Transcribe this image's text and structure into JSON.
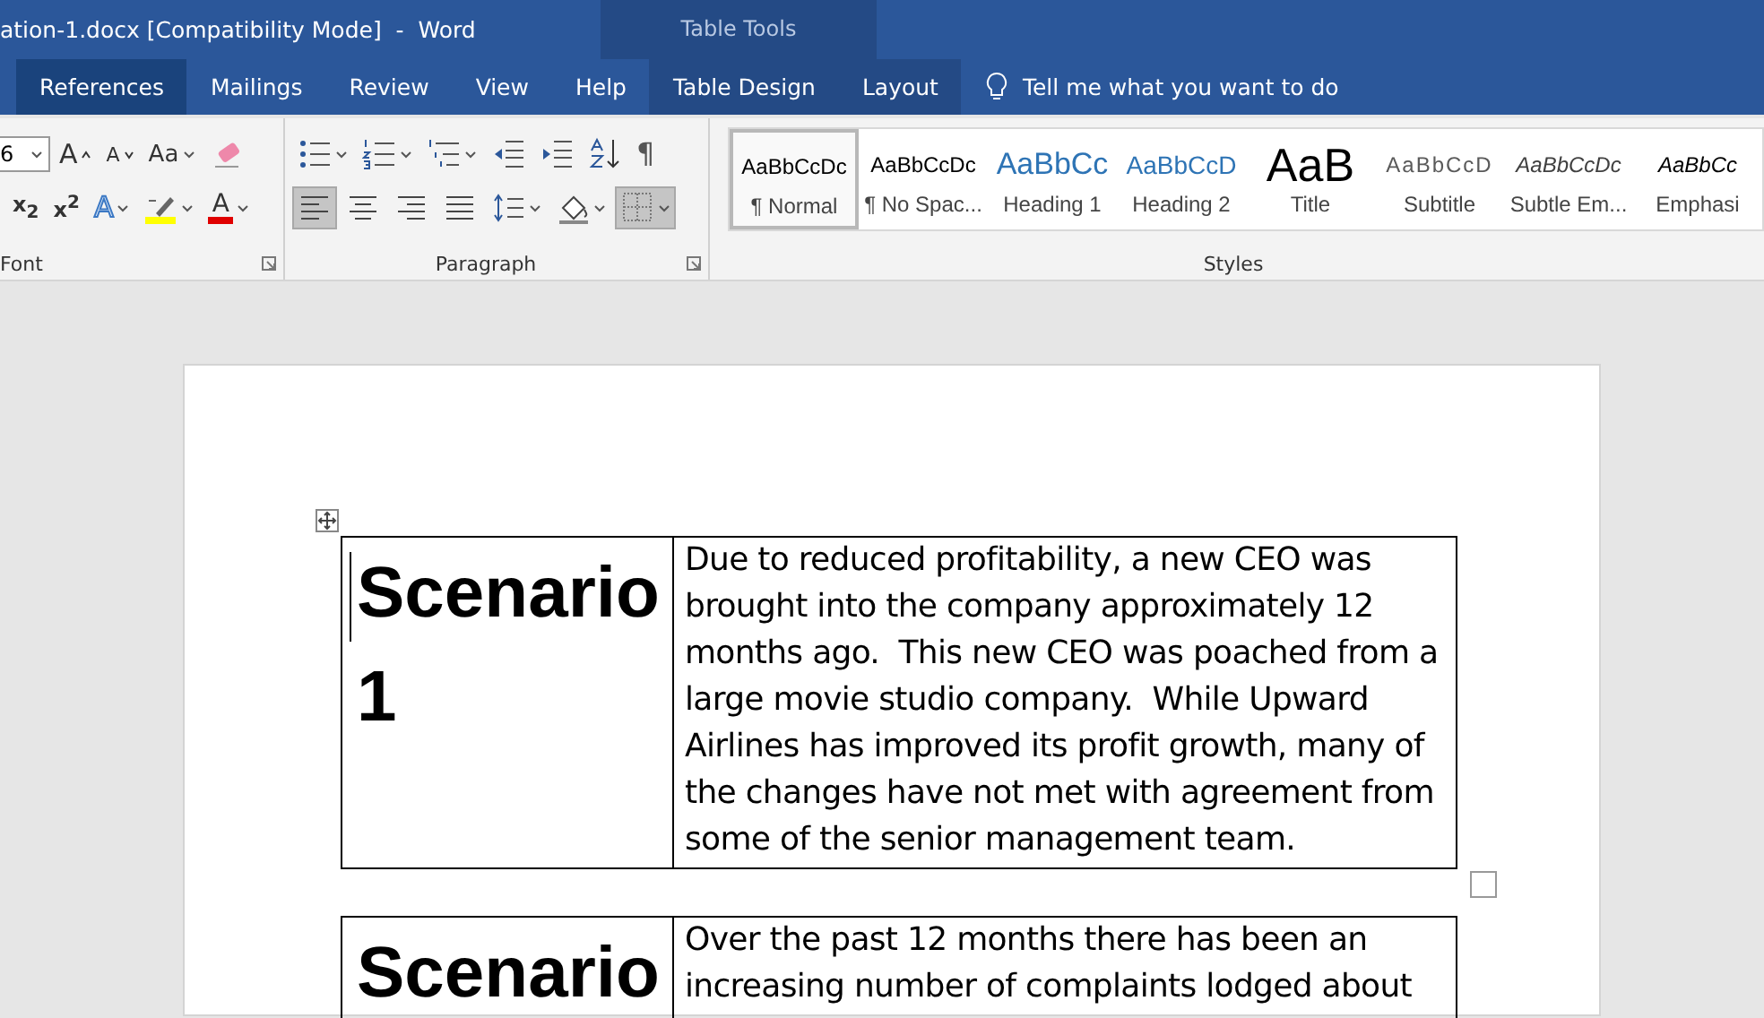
{
  "window": {
    "title": "ation-1.docx [Compatibility Mode]  -  Word",
    "context_title": "Table Tools"
  },
  "tabs": [
    {
      "label": "References",
      "selected": true,
      "context": false
    },
    {
      "label": "Mailings",
      "selected": false,
      "context": false
    },
    {
      "label": "Review",
      "selected": false,
      "context": false
    },
    {
      "label": "View",
      "selected": false,
      "context": false
    },
    {
      "label": "Help",
      "selected": false,
      "context": false
    },
    {
      "label": "Table Design",
      "selected": false,
      "context": true
    },
    {
      "label": "Layout",
      "selected": false,
      "context": true
    }
  ],
  "tell_me": {
    "placeholder": "Tell me what you want to do"
  },
  "font_group": {
    "label": "Font",
    "size": "6",
    "row1": [
      {
        "kind": "grow",
        "glyph": "A",
        "pressed": false
      },
      {
        "kind": "shrink",
        "glyph": "A",
        "pressed": false
      },
      {
        "kind": "case",
        "glyph": "Aa",
        "pressed": false
      },
      {
        "kind": "clear",
        "pressed": false
      }
    ],
    "row2": [
      {
        "kind": "subscript",
        "glyph": "x$_{2}$",
        "pressed": false
      },
      {
        "kind": "superscript",
        "glyph": "x$^{2}$",
        "pressed": false
      },
      {
        "kind": "effects",
        "glyph": "A",
        "pressed": false
      },
      {
        "kind": "highlight",
        "pressed": false
      },
      {
        "kind": "fontcolor",
        "glyph": "A",
        "pressed": false
      }
    ]
  },
  "paragraph_group": {
    "label": "Paragraph",
    "row1": [
      {
        "kind": "bullets",
        "pressed": false
      },
      {
        "kind": "numbering",
        "pressed": false
      },
      {
        "kind": "multilevel",
        "pressed": false
      },
      {
        "kind": "outdent",
        "pressed": false
      },
      {
        "kind": "indent",
        "pressed": false
      },
      {
        "kind": "sort",
        "pressed": false
      },
      {
        "kind": "pilcrow",
        "glyph": "¶",
        "pressed": false
      }
    ],
    "row2": [
      {
        "kind": "alignleft",
        "pressed": true
      },
      {
        "kind": "center",
        "pressed": false
      },
      {
        "kind": "alignright",
        "pressed": false
      },
      {
        "kind": "justify",
        "pressed": false
      },
      {
        "kind": "spacing",
        "pressed": false
      },
      {
        "kind": "shading",
        "pressed": false
      },
      {
        "kind": "borders",
        "pressed": true
      }
    ]
  },
  "styles_group": {
    "label": "Styles",
    "items": [
      {
        "preview": "AaBbCcDc",
        "name": "¶ Normal",
        "kind": "normal",
        "selected": true
      },
      {
        "preview": "AaBbCcDc",
        "name": "¶ No Spac...",
        "kind": "normal",
        "selected": false
      },
      {
        "preview": "AaBbCc",
        "name": "Heading 1",
        "kind": "heading1",
        "selected": false
      },
      {
        "preview": "AaBbCcD",
        "name": "Heading 2",
        "kind": "heading2",
        "selected": false
      },
      {
        "preview": "AaB",
        "name": "Title",
        "kind": "title",
        "selected": false
      },
      {
        "preview": "AaBbCcD",
        "name": "Subtitle",
        "kind": "subtitle",
        "selected": false
      },
      {
        "preview": "AaBbCcDc",
        "name": "Subtle Em...",
        "kind": "subtle",
        "selected": false
      },
      {
        "preview": "AaBbCc",
        "name": "Emphasi",
        "kind": "emphasis",
        "selected": false
      }
    ]
  },
  "document": {
    "tables": [
      {
        "heading": [
          "Scenario",
          "1"
        ],
        "body": [
          "Due to reduced profitability, a new CEO was",
          "brought into the company approximately 12",
          "months ago.  This new CEO was poached from a",
          "large movie studio company.  While Upward",
          "Airlines has improved its profit growth, many of",
          "the changes have not met with agreement from",
          "some of the senior management team."
        ]
      },
      {
        "heading": [
          "Scenario"
        ],
        "body": [
          "Over the past 12 months there has been an",
          "increasing number of complaints lodged about"
        ]
      }
    ]
  }
}
